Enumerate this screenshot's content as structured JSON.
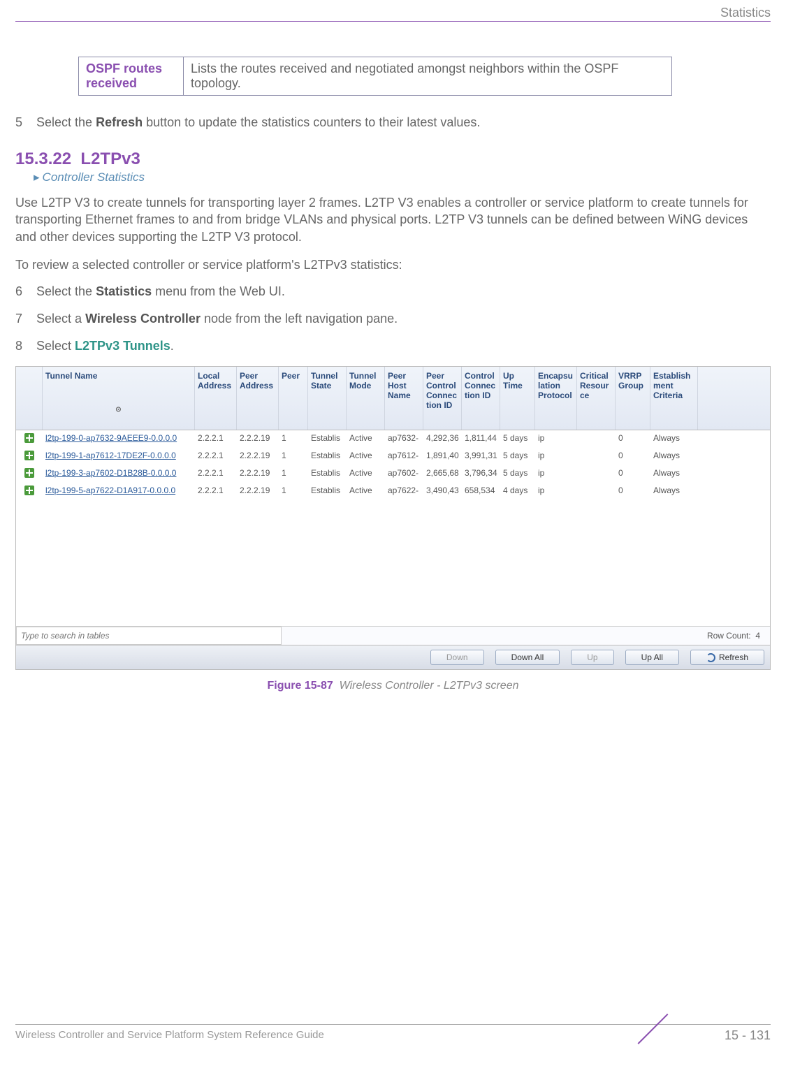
{
  "header": {
    "right_label": "Statistics"
  },
  "info_box": {
    "label": "OSPF routes received",
    "desc": "Lists the routes received and negotiated amongst neighbors within the OSPF topology."
  },
  "step5": {
    "num": "5",
    "pre": "Select the ",
    "bold": "Refresh",
    "post": " button to update the statistics counters to their latest values."
  },
  "section": {
    "number": "15.3.22",
    "title": "L2TPv3",
    "breadcrumb": "Controller Statistics"
  },
  "para1": "Use L2TP V3 to create tunnels for transporting layer 2 frames. L2TP V3 enables a controller or service platform to create tunnels for transporting Ethernet frames to and from bridge VLANs and physical ports. L2TP V3 tunnels can be defined between WiNG devices and other devices supporting the L2TP V3 protocol.",
  "para2": "To review a selected controller or service platform's L2TPv3 statistics:",
  "step6": {
    "num": "6",
    "pre": "Select the ",
    "bold": "Statistics",
    "post": " menu from the Web UI."
  },
  "step7": {
    "num": "7",
    "pre": "Select a ",
    "bold": "Wireless Controller",
    "post": " node from the left navigation pane."
  },
  "step8": {
    "num": "8",
    "pre": "Select ",
    "teal": "L2TPv3 Tunnels",
    "post": "."
  },
  "grid": {
    "headers": [
      "",
      "Tunnel Name",
      "Local Address",
      "Peer Address",
      "Peer",
      "Tunnel State",
      "Tunnel Mode",
      "Peer Host Name",
      "Peer Control Connection ID",
      "Control Connection ID",
      "Up Time",
      "Encapsulation Protocol",
      "Critical Resource",
      "VRRP Group",
      "Establishment Criteria"
    ],
    "rows": [
      {
        "name": "l2tp-199-0-ap7632-9AEEE9-0.0.0.0",
        "local": "2.2.2.1",
        "peer_addr": "2.2.2.19",
        "peer": "1",
        "state": "Establis",
        "mode": "Active",
        "host": "ap7632-",
        "peer_conn": "4,292,36",
        "conn": "1,811,44",
        "up": "5 days",
        "encap": "ip",
        "crit": "",
        "vrrp": "0",
        "estab": "Always"
      },
      {
        "name": "l2tp-199-1-ap7612-17DE2F-0.0.0.0",
        "local": "2.2.2.1",
        "peer_addr": "2.2.2.19",
        "peer": "1",
        "state": "Establis",
        "mode": "Active",
        "host": "ap7612-",
        "peer_conn": "1,891,40",
        "conn": "3,991,31",
        "up": "5 days",
        "encap": "ip",
        "crit": "",
        "vrrp": "0",
        "estab": "Always"
      },
      {
        "name": "l2tp-199-3-ap7602-D1B28B-0.0.0.0",
        "local": "2.2.2.1",
        "peer_addr": "2.2.2.19",
        "peer": "1",
        "state": "Establis",
        "mode": "Active",
        "host": "ap7602-",
        "peer_conn": "2,665,68",
        "conn": "3,796,34",
        "up": "5 days",
        "encap": "ip",
        "crit": "",
        "vrrp": "0",
        "estab": "Always"
      },
      {
        "name": "l2tp-199-5-ap7622-D1A917-0.0.0.0",
        "local": "2.2.2.1",
        "peer_addr": "2.2.2.19",
        "peer": "1",
        "state": "Establis",
        "mode": "Active",
        "host": "ap7622-",
        "peer_conn": "3,490,43",
        "conn": "658,534",
        "up": "4 days",
        "encap": "ip",
        "crit": "",
        "vrrp": "0",
        "estab": "Always"
      }
    ],
    "search_placeholder": "Type to search in tables",
    "row_count_label": "Row  Count:",
    "row_count_value": "4",
    "buttons": {
      "down": "Down",
      "down_all": "Down All",
      "up": "Up",
      "up_all": "Up All",
      "refresh": "Refresh"
    }
  },
  "figure": {
    "label": "Figure 15-87",
    "title": "Wireless Controller - L2TPv3 screen"
  },
  "footer": {
    "text": "Wireless Controller and Service Platform System Reference Guide",
    "page": "15 - 131"
  }
}
